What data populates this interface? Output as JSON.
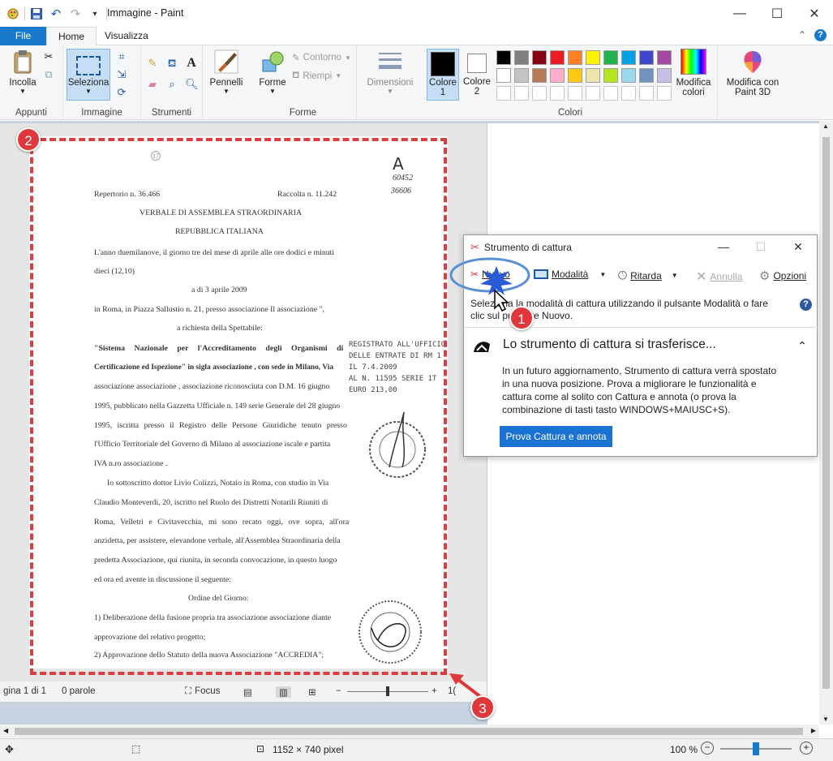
{
  "window": {
    "title": "Immagine - Paint"
  },
  "tabs": {
    "file": "File",
    "home": "Home",
    "view": "Visualizza"
  },
  "ribbon": {
    "paste": "Incolla",
    "clipboard_group": "Appunti",
    "select": "Seleziona",
    "image_group": "Immagine",
    "tools_group": "Strumenti",
    "brushes": "Pennelli",
    "shapes": "Forme",
    "outline": "Contorno",
    "fill": "Riempi",
    "shapes_group": "Forme",
    "size": "Dimensioni",
    "color1_line1": "Colore",
    "color1_line2": "1",
    "color2_line1": "Colore",
    "color2_line2": "2",
    "colors_group": "Colori",
    "edit_colors_line1": "Modifica",
    "edit_colors_line2": "colori",
    "paint3d_line1": "Modifica con",
    "paint3d_line2": "Paint 3D"
  },
  "palette": [
    "#000000",
    "#7f7f7f",
    "#880015",
    "#ed1c24",
    "#ff7f27",
    "#fff200",
    "#22b14c",
    "#00a2e8",
    "#3f48cc",
    "#a349a4",
    "#ffffff",
    "#c3c3c3",
    "#b97a57",
    "#ffaec9",
    "#ffc90e",
    "#efe4b0",
    "#b5e61d",
    "#99d9ea",
    "#7092be",
    "#c8bfe7"
  ],
  "document": {
    "corner_mark": "A",
    "corner_nums1": "60452",
    "corner_nums2": "36606",
    "repertorio": "Repertorio n. 36.466",
    "raccolta": "Raccolta n. 11.242",
    "heading1": "VERBALE DI ASSEMBLEA STRAORDINARIA",
    "heading2": "REPUBBLICA ITALIANA",
    "l1": "L'anno duemilanove, il giorno tre del mese di aprile alle ore dodici e minuti",
    "l2": "dieci (12,10)",
    "l3": "a di 3 aprile 2009",
    "l4": "in Roma, in Piazza Sallustio n. 21, presso associazione Il associazione \",",
    "l5": "a richiesta della Spettabile:",
    "l6": "\"Sistema Nazionale per l'Accreditamento degli Organismi di",
    "l7": "Certificazione ed Ispezione\" in sigla associazione , con sede in Milano, Via",
    "l8": "associazione associazione , associazione riconosciuta con D.M. 16 giugno",
    "l9": "1995, pubblicato nella Gazzetta Ufficiale n. 149 serie Generale del 28 giugno",
    "l10": "1995, iscritta presso il Registro delle Persone Giuridiche tenuto presso",
    "l11": "l'Ufficio Territoriale del Governo di Milano al associazione iscale e partita",
    "l12": "IVA n.ro associazione .",
    "l13": "Io sottoscritto dottor Livio Colizzi, Notaio in Roma, con studio in Via",
    "l14": "Claudio Monteverdi, 20, iscritto nel Ruolo dei Distretti Notarili Riuniti di",
    "l15": "Roma, Velletri e Civitavecchia, mi sono recato oggi, ove sopra, all'ora",
    "l16": "anzidetta, per assistere, elevandone verbale, all'Assemblea Straordinaria della",
    "l17": "predetta Associazione, qui riunita, in seconda convocazione, in questo luogo",
    "l18": "ed ora ed avente in discussione il seguente:",
    "l19": "Ordine del Giorno:",
    "l20": "1) Deliberazione della fusione propria tra associazione associazione diante",
    "l21": "approvazione del relativo progetto;",
    "l22": "2) Approvazione dello Statuto della nuova Associazione \"ACCREDIA\";",
    "stamp1": "REGISTRATO ALL'UFFICIO",
    "stamp2": "DELLE ENTRATE DI RM 1",
    "stamp3": "IL 7.4.2009",
    "stamp4": "AL N. 11595 SERIE 1T",
    "stamp5": "EURO 213,00"
  },
  "word_status": {
    "page": "gina 1 di 1",
    "words": "0 parole",
    "focus": "Focus",
    "zoom_minus": "−",
    "zoom_plus": "+",
    "zoom_pct": "1("
  },
  "snip": {
    "title": "Strumento di cattura",
    "new": "Nuovo",
    "mode": "Modalità",
    "delay": "Ritarda",
    "cancel": "Annulla",
    "options": "Opzioni",
    "hint_line1": "Seleziona la modalità di cattura utilizzando il pulsante Modalità o fare",
    "hint_line2": "clic sul pulsante Nuovo.",
    "banner_title": "Lo strumento di cattura si trasferisce...",
    "banner_body": "In un futuro aggiornamento, Strumento di cattura verrà spostato in una nuova posizione. Prova a migliorare le funzionalità e cattura come al solito con Cattura e annota (o prova la combinazione di tasti tasto WINDOWS+MAIUSC+S).",
    "try_button": "Prova Cattura e annota"
  },
  "annotations": {
    "b1": "1",
    "b2": "2",
    "b3": "3"
  },
  "statusbar": {
    "dimensions": "1152 × 740 pixel",
    "zoom": "100 %",
    "zoom_minus": "−",
    "zoom_plus": "+"
  }
}
